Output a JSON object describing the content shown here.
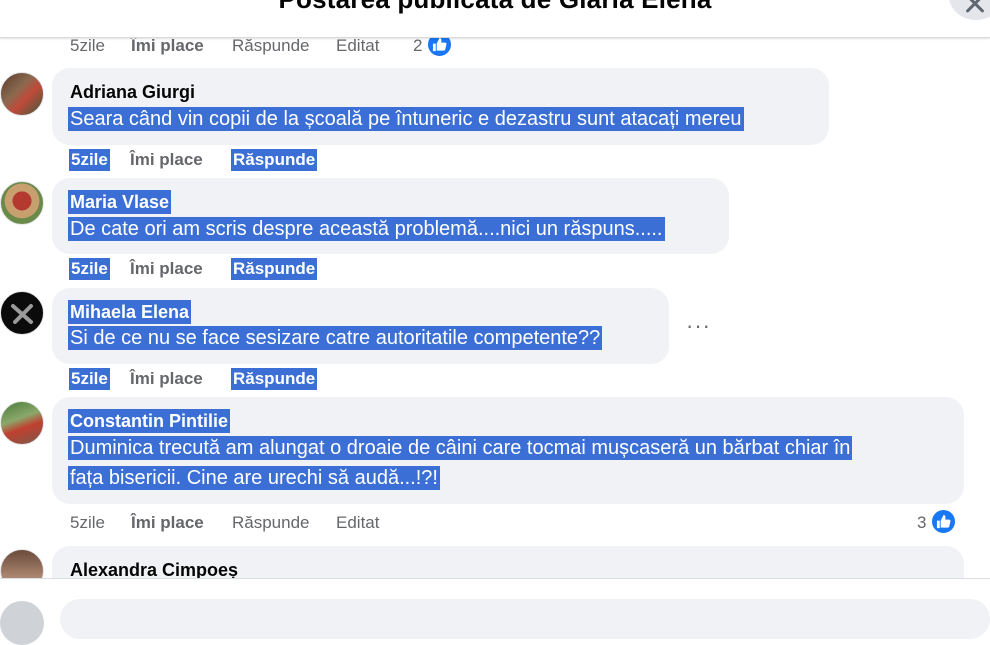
{
  "header": {
    "title": "Postarea publicată de Glaria Elena"
  },
  "top_actions": {
    "time": "5zile",
    "like": "Îmi place",
    "reply": "Răspunde",
    "edited": "Editat",
    "reactions": "2"
  },
  "comments": [
    {
      "author": "Adriana Giurgi",
      "text": "Seara când vin copii de la școală pe întuneric e dezastru sunt atacați mereu",
      "time": "5zile",
      "like": "Îmi place",
      "reply": "Răspunde"
    },
    {
      "author": "Maria Vlase",
      "text": "De cate ori am scris despre această problemă....nici un răspuns.....",
      "time": "5zile",
      "like": "Îmi place",
      "reply": "Răspunde"
    },
    {
      "author": "Mihaela Elena",
      "text": "Si de ce nu se face sesizare catre autoritatile competente??",
      "time": "5zile",
      "like": "Îmi place",
      "reply": "Răspunde",
      "more": "···"
    },
    {
      "author": "Constantin Pintilie",
      "text_line1": "Duminica trecută am alungat o droaie de câini care tocmai mușcaseră un bărbat chiar în",
      "text_line2": "fața bisericii. Cine are urechi să audă...!?!",
      "time": "5zile",
      "like": "Îmi place",
      "reply": "Răspunde",
      "edited": "Editat",
      "reactions": "3"
    },
    {
      "author": "Alexandra Cimpoeș"
    }
  ],
  "colors": {
    "selection": "#3b6fd6",
    "bubble": "#f0f2f5",
    "like_blue": "#1877f2",
    "meta_gray": "#65676b"
  }
}
